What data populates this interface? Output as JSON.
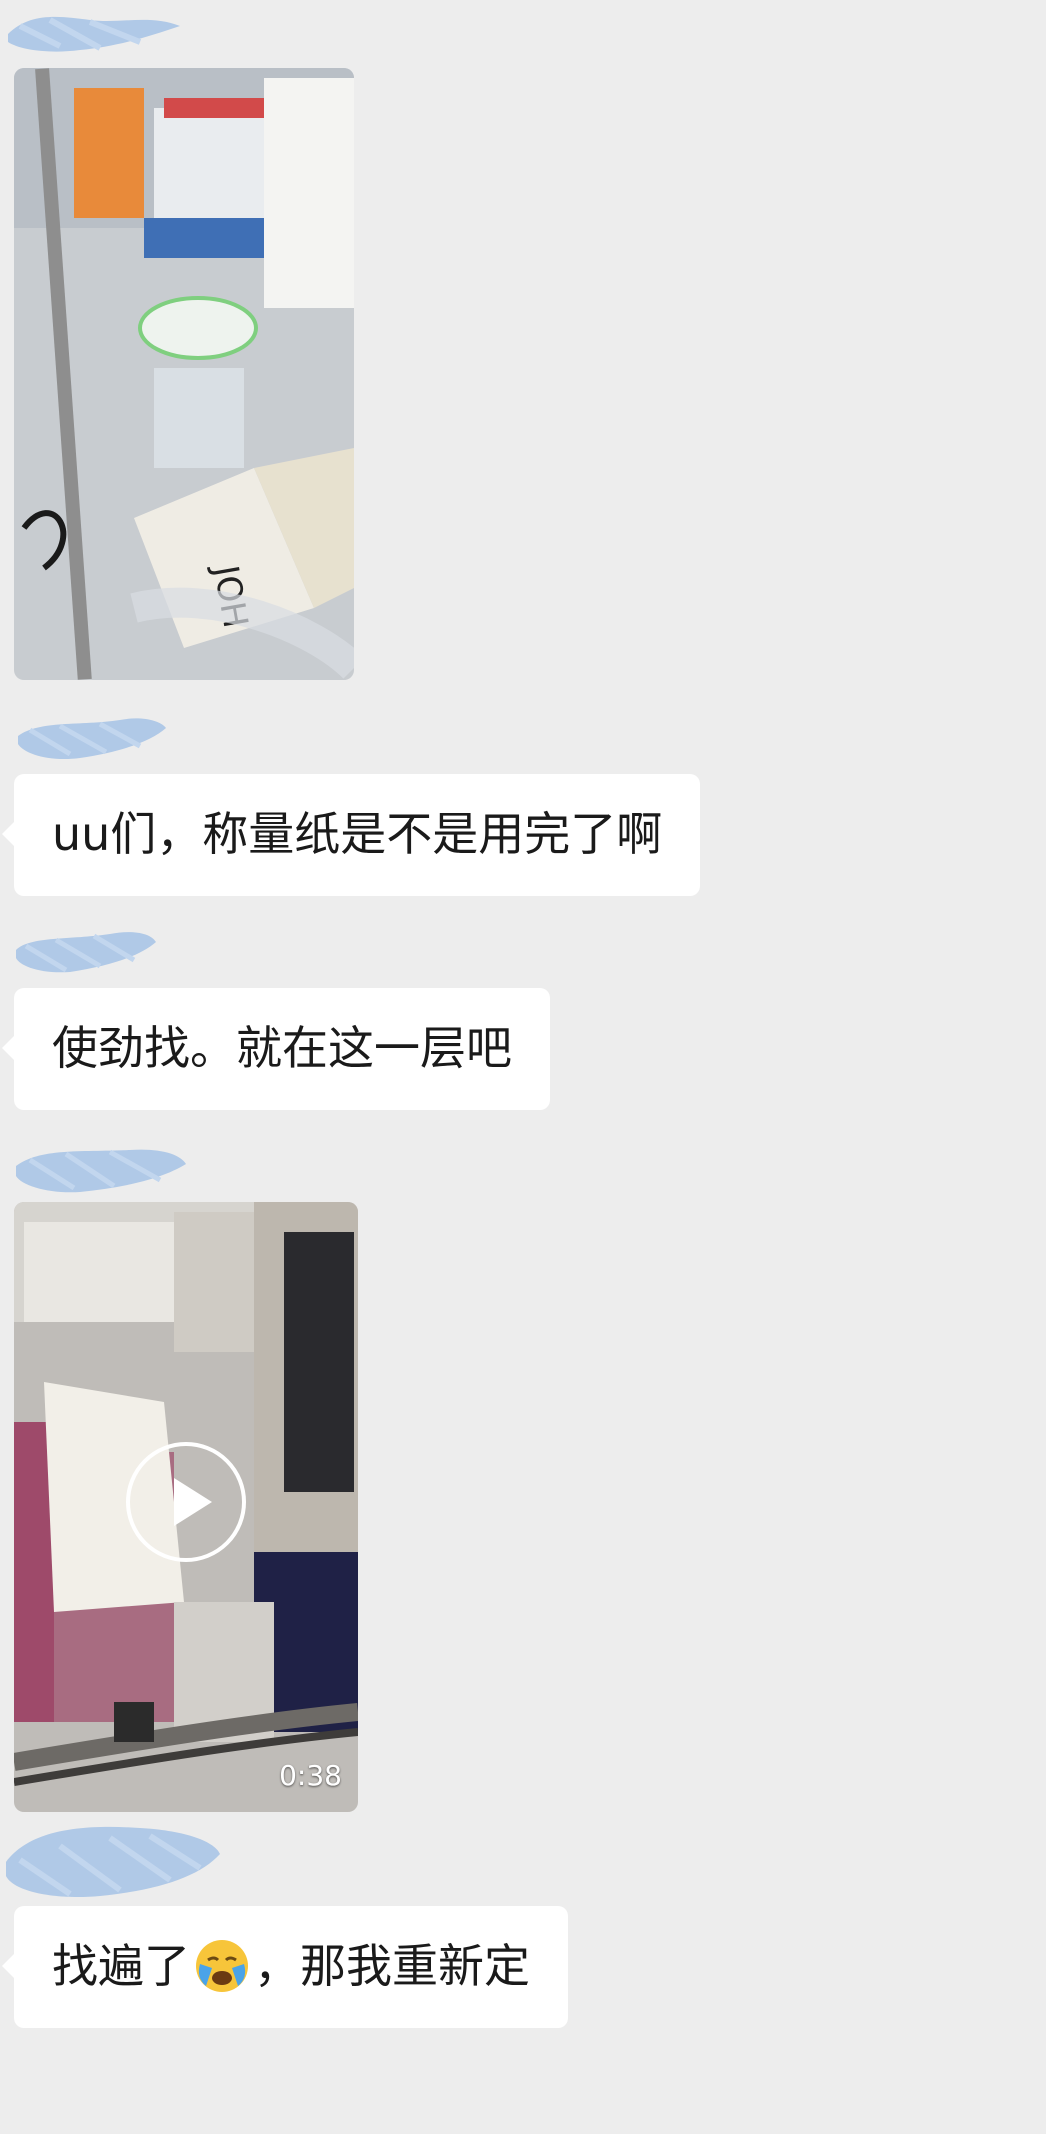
{
  "messages": [
    {
      "type": "image",
      "sender": "redacted"
    },
    {
      "type": "text",
      "sender": "redacted",
      "text": "uu们，称量纸是不是用完了啊"
    },
    {
      "type": "text",
      "sender": "redacted",
      "text": "使劲找。就在这一层吧"
    },
    {
      "type": "video",
      "sender": "redacted",
      "duration": "0:38"
    },
    {
      "type": "text",
      "sender": "redacted",
      "text_before": "找遍了",
      "emoji": "crying-face",
      "text_after": "，那我重新定"
    }
  ],
  "colors": {
    "background": "#ededed",
    "bubble": "#ffffff",
    "redaction": "#a9c4e6"
  }
}
